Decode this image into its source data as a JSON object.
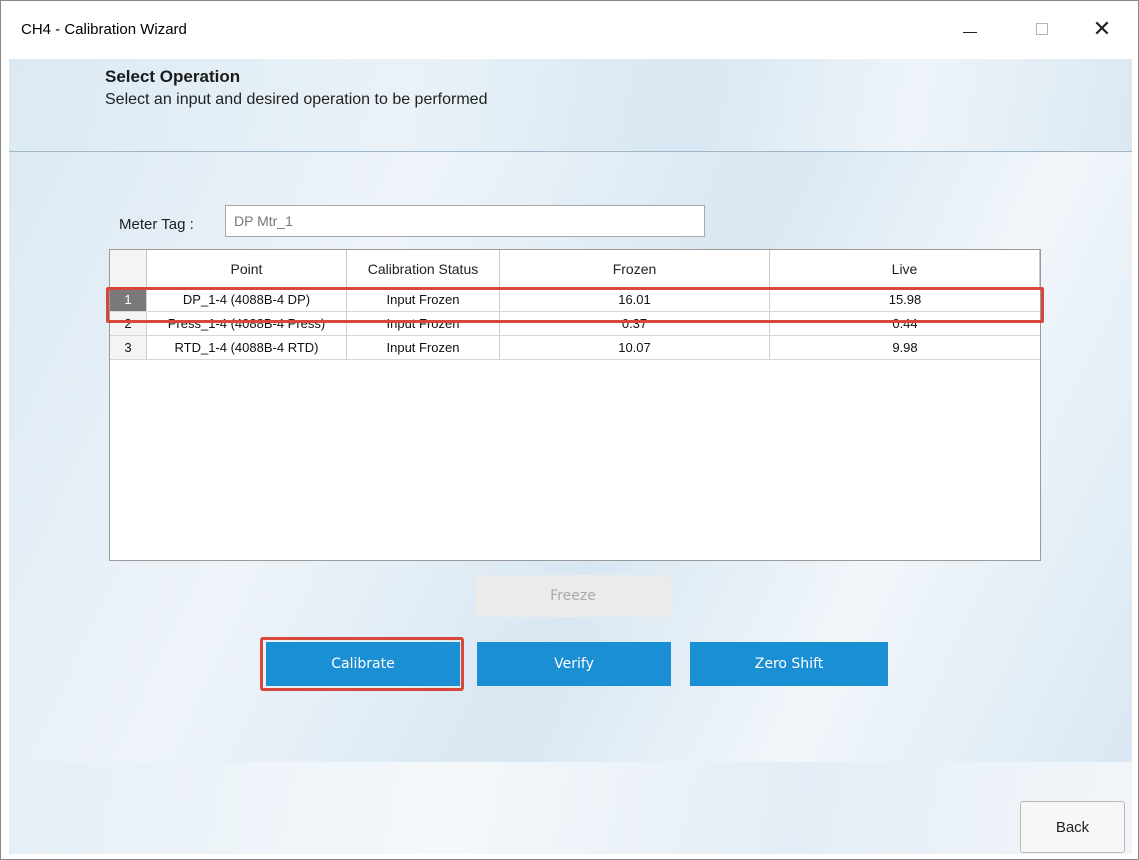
{
  "window": {
    "title": "CH4 - Calibration Wizard"
  },
  "header": {
    "title": "Select Operation",
    "subtitle": "Select an input and desired operation to be performed"
  },
  "meter": {
    "label": "Meter Tag :",
    "value": "DP Mtr_1"
  },
  "grid": {
    "columns": [
      "Point",
      "Calibration Status",
      "Frozen",
      "Live"
    ],
    "rows": [
      {
        "index": "1",
        "point": "DP_1-4 (4088B-4 DP)",
        "status": "Input Frozen",
        "frozen": "16.01",
        "live": "15.98",
        "selected": true
      },
      {
        "index": "2",
        "point": "Press_1-4 (4088B-4 Press)",
        "status": "Input Frozen",
        "frozen": "0.37",
        "live": "0.44",
        "selected": false
      },
      {
        "index": "3",
        "point": "RTD_1-4 (4088B-4 RTD)",
        "status": "Input Frozen",
        "frozen": "10.07",
        "live": "9.98",
        "selected": false
      }
    ]
  },
  "buttons": {
    "freeze": "Freeze",
    "calibrate": "Calibrate",
    "verify": "Verify",
    "zero_shift": "Zero Shift",
    "back": "Back"
  },
  "colors": {
    "accent": "#1a8fd3",
    "highlight": "#d9463b",
    "disabled": "#ebebeb"
  },
  "icons": {
    "minimize": "minimize-icon",
    "maximize": "maximize-icon",
    "close": "close-icon"
  }
}
